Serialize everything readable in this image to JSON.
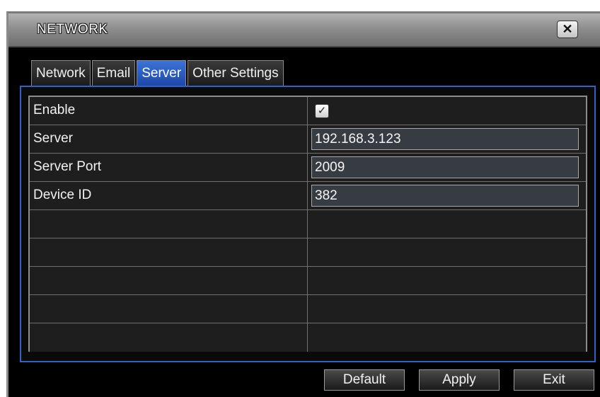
{
  "window": {
    "title": "NETWORK",
    "close_glyph": "✕"
  },
  "tabs": [
    {
      "label": "Network",
      "active": false
    },
    {
      "label": "Email",
      "active": false
    },
    {
      "label": "Server",
      "active": true
    },
    {
      "label": "Other Settings",
      "active": false
    }
  ],
  "form": {
    "enable": {
      "label": "Enable",
      "checked": true,
      "glyph": "✓"
    },
    "server": {
      "label": "Server",
      "value": "192.168.3.123"
    },
    "server_port": {
      "label": "Server Port",
      "value": "2009"
    },
    "device_id": {
      "label": "Device ID",
      "value": "382"
    }
  },
  "buttons": {
    "default": "Default",
    "apply": "Apply",
    "exit": "Exit"
  },
  "colors": {
    "accent_blue": "#2f63c9",
    "active_tab": "#3b73d8",
    "field_bg": "#373b42"
  }
}
